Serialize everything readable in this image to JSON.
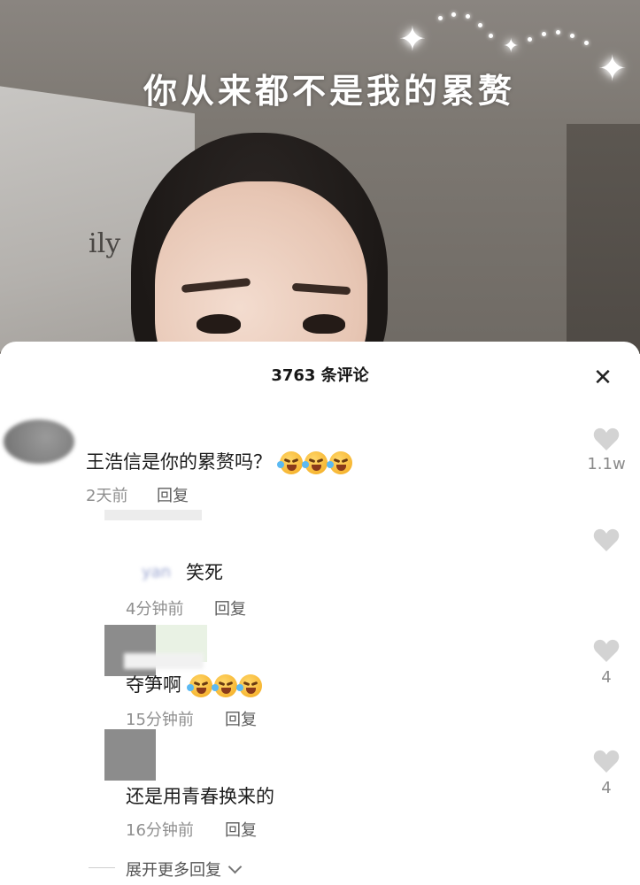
{
  "video": {
    "caption": "你从来都不是我的累赘",
    "wall_text": "ily"
  },
  "sheet": {
    "title": "3763 条评论",
    "close_label": "✕"
  },
  "comments": [
    {
      "text": "王浩信是你的累赘吗？",
      "emojis": 3,
      "time": "2天前",
      "reply": "回复",
      "likes": "1.1w"
    },
    {
      "username_partial": "yan",
      "text": "笑死",
      "time": "4分钟前",
      "reply": "回复",
      "likes": ""
    },
    {
      "text": "夺笋啊",
      "emojis": 3,
      "time": "15分钟前",
      "reply": "回复",
      "likes": "4"
    },
    {
      "text": "还是用青春换来的",
      "time": "16分钟前",
      "reply": "回复",
      "likes": "4"
    }
  ],
  "expand_label": "展开更多回复",
  "colors": {
    "sheet_bg": "#ffffff",
    "text": "#1c1c1c",
    "meta": "#8f8f8f",
    "heart": "#d3d3d3"
  }
}
